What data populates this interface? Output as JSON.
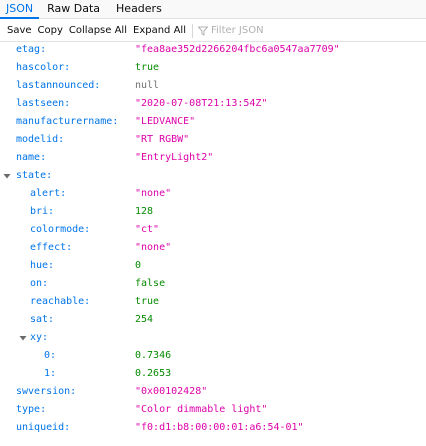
{
  "tabs": [
    "JSON",
    "Raw Data",
    "Headers"
  ],
  "toolbar": {
    "save": "Save",
    "copy": "Copy",
    "collapse_all": "Collapse All",
    "expand_all": "Expand All",
    "filter_placeholder": "Filter JSON"
  },
  "rows": [
    {
      "key": "etag:",
      "value": "\"fea8ae352d2266204fbc6a0547aa7709\""
    },
    {
      "key": "hascolor:",
      "value": "true"
    },
    {
      "key": "lastannounced:",
      "value": "null"
    },
    {
      "key": "lastseen:",
      "value": "\"2020-07-08T21:13:54Z\""
    },
    {
      "key": "manufacturername:",
      "value": "\"LEDVANCE\""
    },
    {
      "key": "modelid:",
      "value": "\"RT RGBW\""
    },
    {
      "key": "name:",
      "value": "\"EntryLight2\""
    },
    {
      "key": "state:",
      "value": ""
    },
    {
      "key": "alert:",
      "value": "\"none\""
    },
    {
      "key": "bri:",
      "value": "128"
    },
    {
      "key": "colormode:",
      "value": "\"ct\""
    },
    {
      "key": "effect:",
      "value": "\"none\""
    },
    {
      "key": "hue:",
      "value": "0"
    },
    {
      "key": "on:",
      "value": "false"
    },
    {
      "key": "reachable:",
      "value": "true"
    },
    {
      "key": "sat:",
      "value": "254"
    },
    {
      "key": "xy:",
      "value": ""
    },
    {
      "key": "0:",
      "value": "0.7346"
    },
    {
      "key": "1:",
      "value": "0.2653"
    },
    {
      "key": "swversion:",
      "value": "\"0x00102428\""
    },
    {
      "key": "type:",
      "value": "\"Color dimmable light\""
    },
    {
      "key": "uniqueid:",
      "value": "\"f0:d1:b8:00:00:01:a6:54-01\""
    }
  ]
}
